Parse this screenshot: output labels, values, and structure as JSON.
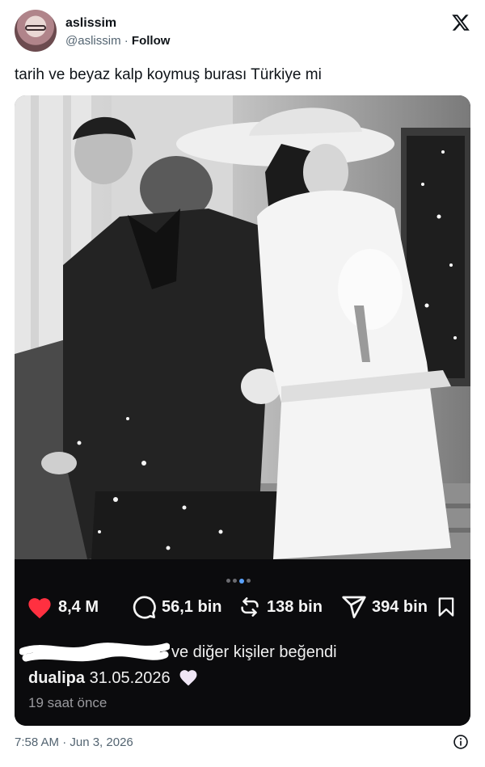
{
  "author": {
    "display_name": "aslissim",
    "handle": "@aslissim",
    "separator": " · ",
    "follow_label": "Follow",
    "avatar_icon": "avatar"
  },
  "brand_icon": "x-logo-icon",
  "tweet": {
    "text": "tarih ve beyaz kalp koymuş burası Türkiye mi",
    "timestamp": "7:58 AM · Jun 3, 2026"
  },
  "embedded_post": {
    "carousel": {
      "count": 4,
      "active_index": 2
    },
    "stats": {
      "likes": "8,4 M",
      "comments": "56,1 bin",
      "reposts": "138 bin",
      "shares": "394 bin"
    },
    "liked_by_suffix": "ve diğer kişiler beğendi",
    "caption_user": "dualipa",
    "caption_text": "31.05.2026",
    "time_ago": "19 saat önce",
    "colors": {
      "like": "#ff3040",
      "panel_bg": "#0b0b0d",
      "active_dot": "#5aa2ff"
    }
  }
}
